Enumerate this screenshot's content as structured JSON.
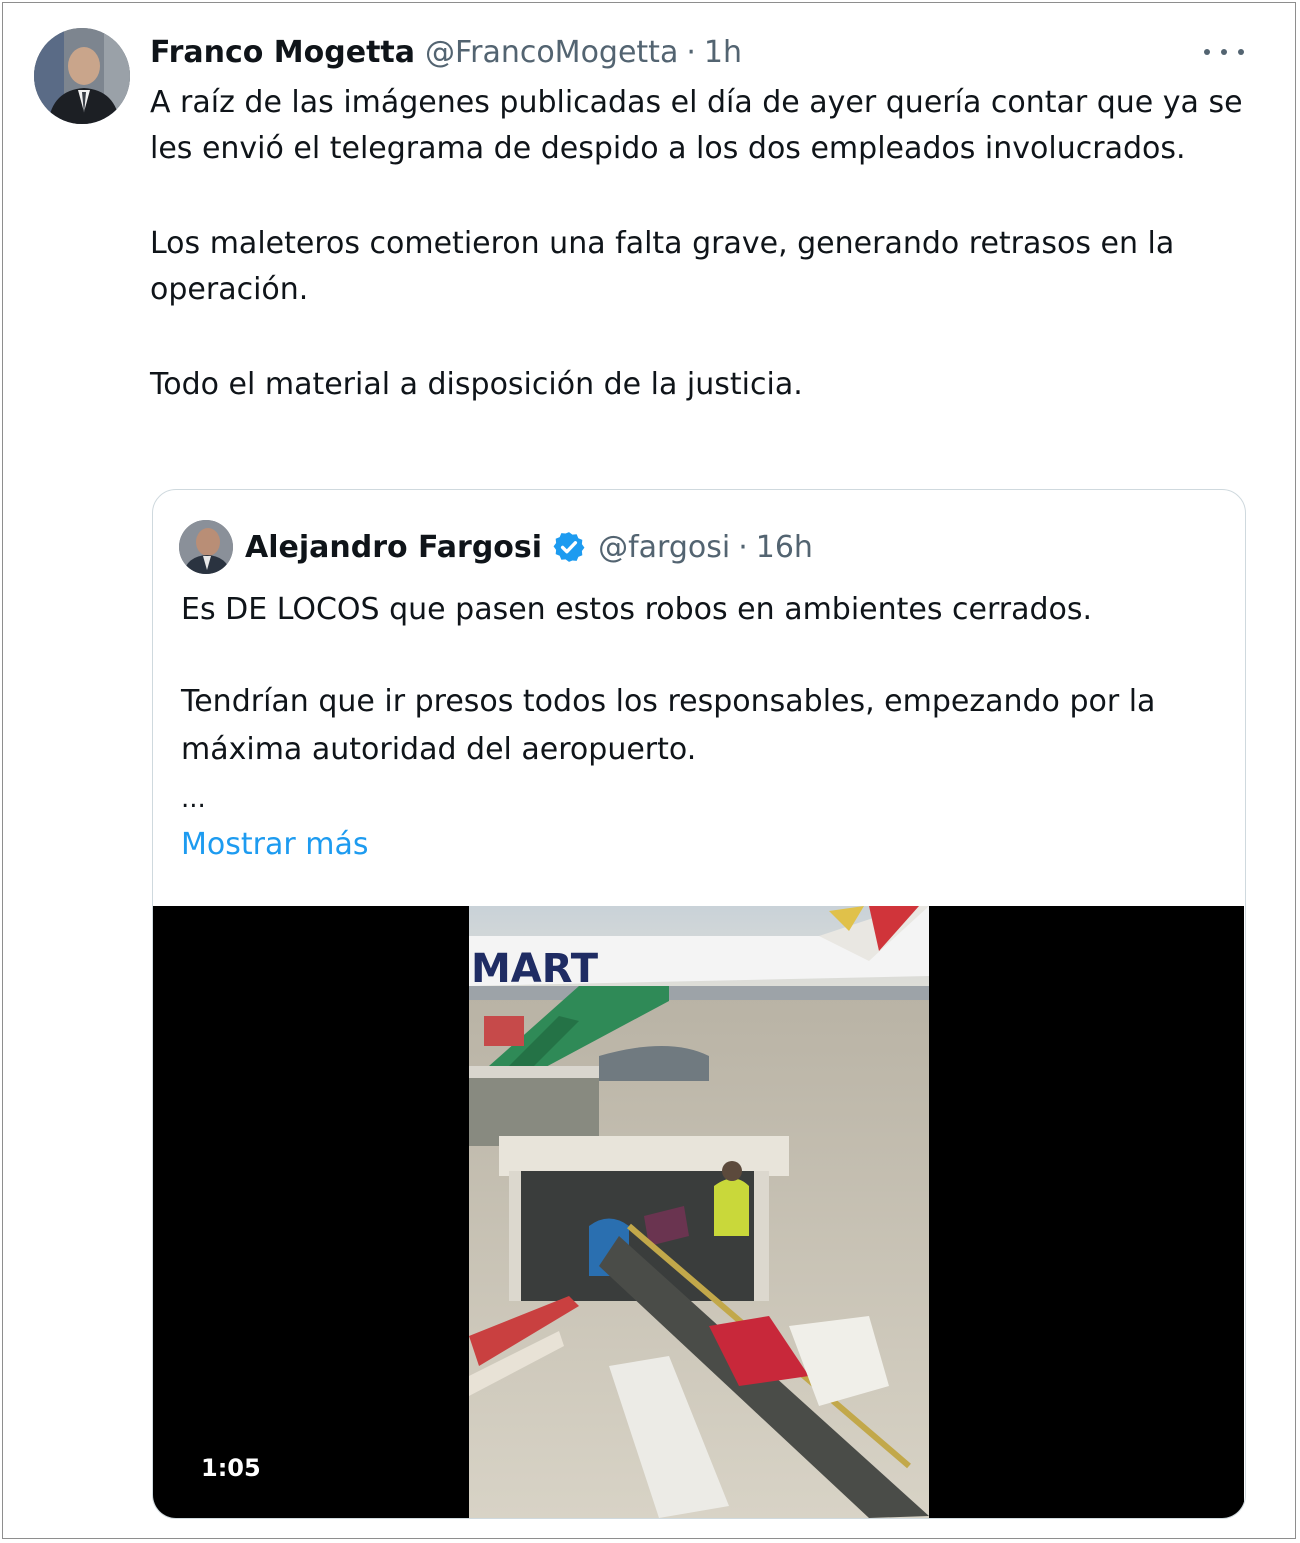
{
  "tweet": {
    "author_name": "Franco Mogetta",
    "handle": "@FrancoMogetta",
    "separator": "·",
    "time": "1h",
    "paragraphs": [
      "A raíz de las imágenes publicadas el día de ayer quería contar que ya se les envió el telegrama de despido a los dos empleados involucrados.",
      "Los maleteros cometieron una falta grave, generando retrasos en la operación.",
      "Todo el material a disposición de la justicia."
    ],
    "more_icon": "more-horizontal-icon"
  },
  "quoted": {
    "author_name": "Alejandro Fargosi",
    "verified_icon": "verified-badge-icon",
    "handle": "@fargosi",
    "separator": "·",
    "time": "16h",
    "paragraphs": [
      "Es DE LOCOS que pasen estos robos en ambientes cerrados.",
      "Tendrían que ir presos todos los responsables, empezando por la máxima autoridad del aeropuerto."
    ],
    "ellipsis": "...",
    "show_more": "Mostrar más",
    "video": {
      "duration": "1:05",
      "plane_text": "MART"
    }
  },
  "colors": {
    "text": "#0f1419",
    "secondary": "#536471",
    "link": "#1d9bf0",
    "border": "#cfd9de"
  }
}
